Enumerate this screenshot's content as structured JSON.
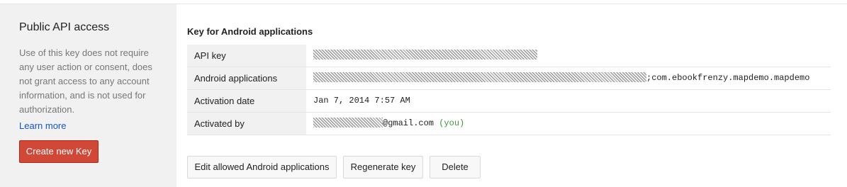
{
  "sidebar": {
    "title": "Public API access",
    "description": "Use of this key does not require any user action or consent, does not grant access to any account information, and is not used for authorization.",
    "learn_more": "Learn more",
    "create_button": "Create new Key"
  },
  "section": {
    "title": "Key for Android applications"
  },
  "table": {
    "rows": [
      {
        "label": "API key"
      },
      {
        "label": "Android applications",
        "value": ";com.ebookfrenzy.mapdemo.mapdemo"
      },
      {
        "label": "Activation date",
        "value": "Jan 7, 2014 7:57 AM"
      },
      {
        "label": "Activated by",
        "value": "@gmail.com",
        "note": "(you)"
      }
    ]
  },
  "actions": {
    "edit": "Edit allowed Android applications",
    "regenerate": "Regenerate key",
    "delete": "Delete"
  },
  "colors": {
    "create_button": "#d14836",
    "link": "#1155cc",
    "you_note": "#3a9a3a"
  }
}
